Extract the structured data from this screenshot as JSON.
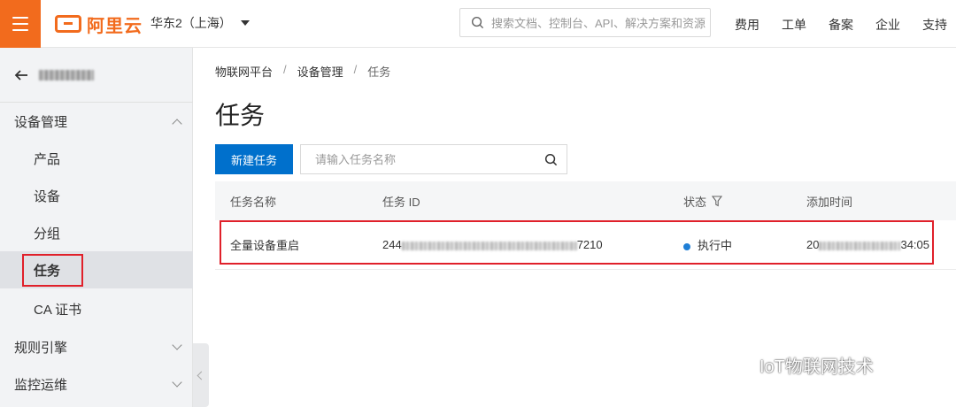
{
  "topbar": {
    "logo_text": "阿里云",
    "region": "华东2（上海）",
    "search_placeholder": "搜索文档、控制台、API、解决方案和资源",
    "nav": [
      "费用",
      "工单",
      "备案",
      "企业",
      "支持"
    ]
  },
  "sidebar": {
    "back_label": "",
    "groups": {
      "device_mgmt": "设备管理",
      "rules_engine": "规则引擎",
      "monitoring": "监控运维"
    },
    "items": [
      "产品",
      "设备",
      "分组",
      "任务",
      "CA 证书"
    ]
  },
  "main": {
    "breadcrumb": [
      "物联网平台",
      "设备管理",
      "任务"
    ],
    "title": "任务",
    "new_task_button": "新建任务",
    "task_search_placeholder": "请输入任务名称",
    "table": {
      "headers": [
        "任务名称",
        "任务 ID",
        "状态",
        "添加时间"
      ],
      "rows": [
        {
          "name": "全量设备重启",
          "id_prefix": "244",
          "id_suffix": "7210",
          "status": "执行中",
          "time_prefix": "20",
          "time_suffix": "34:05"
        }
      ]
    }
  },
  "watermark": "IoT物联网技术",
  "colors": {
    "brand": "#f26b1d",
    "primary": "#0070cc",
    "status_running": "#1f7fd6",
    "highlight": "#e0202a"
  }
}
